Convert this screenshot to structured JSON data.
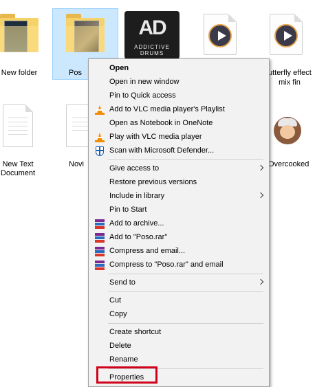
{
  "desktop": {
    "items": [
      {
        "label": "New folder"
      },
      {
        "label": "Pos"
      },
      {
        "label": "ADDICTIVE DRUMS 2"
      },
      {
        "label": ""
      },
      {
        "label_line1": "utterfly effect",
        "label_line2": "mix fin"
      },
      {
        "label_line1": "New Text",
        "label_line2": "Document"
      },
      {
        "label": "Novi"
      },
      {
        "label": "Overcooked"
      }
    ],
    "ad_logo": "AD",
    "ad_text": "ADDICTIVE DRUMS"
  },
  "context_menu": {
    "groups": [
      [
        {
          "label": "Open",
          "bold": true,
          "icon": ""
        },
        {
          "label": "Open in new window",
          "icon": ""
        },
        {
          "label": "Pin to Quick access",
          "icon": ""
        },
        {
          "label": "Add to VLC media player's Playlist",
          "icon": "vlc-icon"
        },
        {
          "label": "Open as Notebook in OneNote",
          "icon": ""
        },
        {
          "label": "Play with VLC media player",
          "icon": "vlc-icon"
        },
        {
          "label": "Scan with Microsoft Defender...",
          "icon": "defender-icon"
        }
      ],
      [
        {
          "label": "Give access to",
          "icon": "",
          "submenu": true
        },
        {
          "label": "Restore previous versions",
          "icon": ""
        },
        {
          "label": "Include in library",
          "icon": "",
          "submenu": true
        },
        {
          "label": "Pin to Start",
          "icon": ""
        },
        {
          "label": "Add to archive...",
          "icon": "winrar-icon"
        },
        {
          "label": "Add to \"Poso.rar\"",
          "icon": "winrar-icon"
        },
        {
          "label": "Compress and email...",
          "icon": "winrar-icon"
        },
        {
          "label": "Compress to \"Poso.rar\" and email",
          "icon": "winrar-icon"
        }
      ],
      [
        {
          "label": "Send to",
          "icon": "",
          "submenu": true
        }
      ],
      [
        {
          "label": "Cut",
          "icon": ""
        },
        {
          "label": "Copy",
          "icon": ""
        }
      ],
      [
        {
          "label": "Create shortcut",
          "icon": ""
        },
        {
          "label": "Delete",
          "icon": ""
        },
        {
          "label": "Rename",
          "icon": ""
        }
      ],
      [
        {
          "label": "Properties",
          "icon": "",
          "highlighted": true
        }
      ]
    ]
  },
  "colors": {
    "highlight": "#d0021b",
    "selection": "#cce8ff"
  }
}
